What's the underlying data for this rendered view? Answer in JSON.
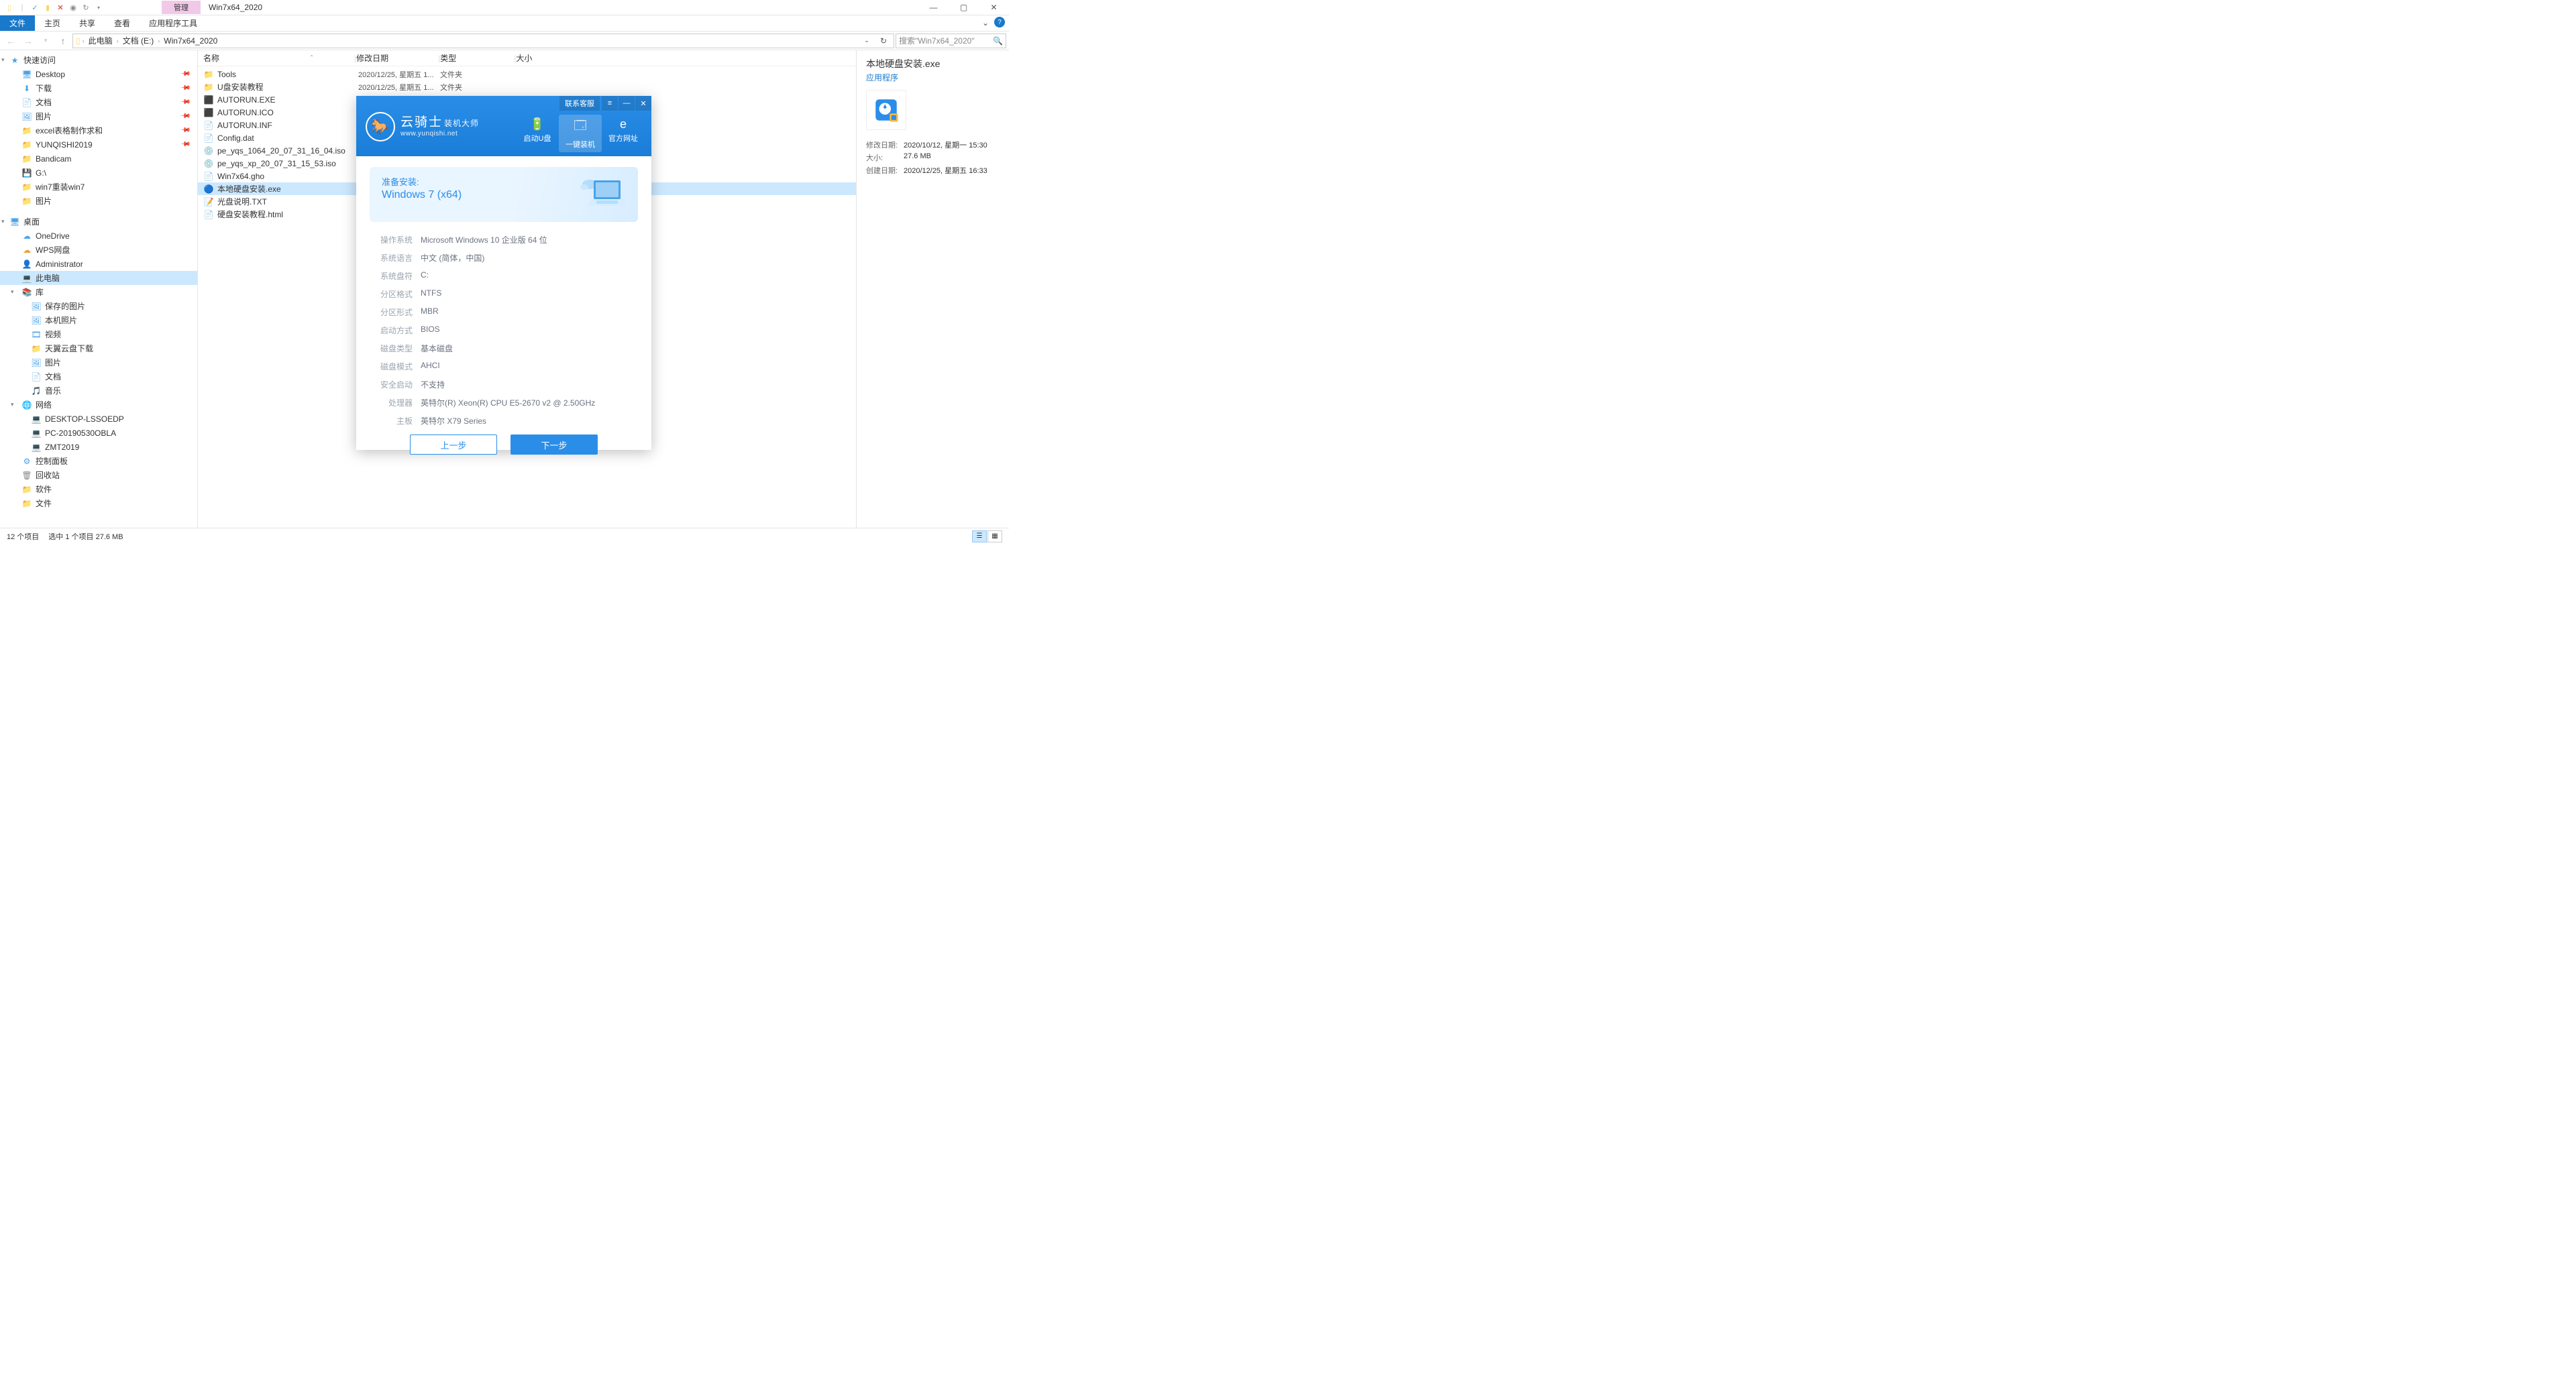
{
  "window": {
    "title": "Win7x64_2020",
    "manage_tab": "管理"
  },
  "ribbon": {
    "file": "文件",
    "tabs": [
      "主页",
      "共享",
      "查看",
      "应用程序工具"
    ]
  },
  "address": {
    "crumbs": [
      "此电脑",
      "文档 (E:)",
      "Win7x64_2020"
    ],
    "search_placeholder": "搜索\"Win7x64_2020\""
  },
  "nav": {
    "quick": {
      "label": "快速访问",
      "items": [
        {
          "label": "Desktop",
          "icon": "🖥",
          "cls": "ico-blue",
          "pin": true
        },
        {
          "label": "下载",
          "icon": "⬇",
          "cls": "ico-blue",
          "pin": true
        },
        {
          "label": "文档",
          "icon": "📄",
          "cls": "ico-blue",
          "pin": true
        },
        {
          "label": "图片",
          "icon": "🖼",
          "cls": "ico-blue",
          "pin": true
        },
        {
          "label": "excel表格制作求和",
          "icon": "📁",
          "cls": "ico-folder",
          "pin": true
        },
        {
          "label": "YUNQISHI2019",
          "icon": "📁",
          "cls": "ico-folder",
          "pin": true
        },
        {
          "label": "Bandicam",
          "icon": "📁",
          "cls": "ico-folder",
          "pin": false
        },
        {
          "label": "G:\\",
          "icon": "💾",
          "cls": "ico-disk",
          "pin": false
        },
        {
          "label": "win7重装win7",
          "icon": "📁",
          "cls": "ico-folder",
          "pin": false
        },
        {
          "label": "图片",
          "icon": "📁",
          "cls": "ico-folder",
          "pin": false
        }
      ]
    },
    "desktop": {
      "label": "桌面",
      "items": [
        {
          "label": "OneDrive",
          "icon": "☁",
          "cls": "ico-blue"
        },
        {
          "label": "WPS网盘",
          "icon": "☁",
          "cls": "ico-orange"
        },
        {
          "label": "Administrator",
          "icon": "👤",
          "cls": "ico-orange"
        },
        {
          "label": "此电脑",
          "icon": "💻",
          "cls": "ico-pc",
          "sel": true
        },
        {
          "label": "库",
          "icon": "📚",
          "cls": "ico-folder",
          "expandable": true,
          "children": [
            {
              "label": "保存的图片",
              "icon": "🖼",
              "cls": "ico-blue"
            },
            {
              "label": "本机照片",
              "icon": "🖼",
              "cls": "ico-blue"
            },
            {
              "label": "视频",
              "icon": "🎞",
              "cls": "ico-blue"
            },
            {
              "label": "天翼云盘下载",
              "icon": "📁",
              "cls": "ico-blue"
            },
            {
              "label": "图片",
              "icon": "🖼",
              "cls": "ico-blue"
            },
            {
              "label": "文档",
              "icon": "📄",
              "cls": "ico-blue"
            },
            {
              "label": "音乐",
              "icon": "🎵",
              "cls": "ico-blue"
            }
          ]
        },
        {
          "label": "网络",
          "icon": "🌐",
          "cls": "ico-net",
          "expandable": true,
          "children": [
            {
              "label": "DESKTOP-LSSOEDP",
              "icon": "💻",
              "cls": "ico-pc"
            },
            {
              "label": "PC-20190530OBLA",
              "icon": "💻",
              "cls": "ico-pc"
            },
            {
              "label": "ZMT2019",
              "icon": "💻",
              "cls": "ico-pc"
            }
          ]
        },
        {
          "label": "控制面板",
          "icon": "⚙",
          "cls": "ico-blue"
        },
        {
          "label": "回收站",
          "icon": "🗑",
          "cls": "ico-grey"
        },
        {
          "label": "软件",
          "icon": "📁",
          "cls": "ico-folder"
        },
        {
          "label": "文件",
          "icon": "📁",
          "cls": "ico-folder"
        }
      ]
    }
  },
  "columns": {
    "name": "名称",
    "date": "修改日期",
    "type": "类型",
    "size": "大小"
  },
  "files": [
    {
      "name": "Tools",
      "icon": "📁",
      "cls": "ico-folder",
      "date": "2020/12/25, 星期五 1...",
      "type": "文件夹",
      "size": ""
    },
    {
      "name": "U盘安装教程",
      "icon": "📁",
      "cls": "ico-folder",
      "date": "2020/12/25, 星期五 1...",
      "type": "文件夹",
      "size": ""
    },
    {
      "name": "AUTORUN.EXE",
      "icon": "⬛",
      "cls": "ico-green",
      "date": "",
      "type": "",
      "size": ""
    },
    {
      "name": "AUTORUN.ICO",
      "icon": "⬛",
      "cls": "ico-green",
      "date": "",
      "type": "",
      "size": ""
    },
    {
      "name": "AUTORUN.INF",
      "icon": "📄",
      "cls": "ico-grey",
      "date": "",
      "type": "",
      "size": ""
    },
    {
      "name": "Config.dat",
      "icon": "📄",
      "cls": "ico-grey",
      "date": "",
      "type": "",
      "size": ""
    },
    {
      "name": "pe_yqs_1064_20_07_31_16_04.iso",
      "icon": "💿",
      "cls": "ico-cd",
      "date": "",
      "type": "",
      "size": ""
    },
    {
      "name": "pe_yqs_xp_20_07_31_15_53.iso",
      "icon": "💿",
      "cls": "ico-cd",
      "date": "",
      "type": "",
      "size": ""
    },
    {
      "name": "Win7x64.gho",
      "icon": "📄",
      "cls": "ico-grey",
      "date": "",
      "type": "",
      "size": ""
    },
    {
      "name": "本地硬盘安装.exe",
      "icon": "🔵",
      "cls": "ico-blue",
      "date": "",
      "type": "",
      "size": "",
      "sel": true
    },
    {
      "name": "光盘说明.TXT",
      "icon": "📝",
      "cls": "ico-grey",
      "date": "",
      "type": "",
      "size": ""
    },
    {
      "name": "硬盘安装教程.html",
      "icon": "📄",
      "cls": "ico-grey",
      "date": "",
      "type": "",
      "size": ""
    }
  ],
  "details": {
    "title": "本地硬盘安装.exe",
    "type": "应用程序",
    "rows": [
      {
        "label": "修改日期:",
        "val": "2020/10/12, 星期一 15:30"
      },
      {
        "label": "大小:",
        "val": "27.6 MB"
      },
      {
        "label": "创建日期:",
        "val": "2020/12/25, 星期五 16:33"
      }
    ]
  },
  "status": {
    "count": "12 个项目",
    "sel": "选中 1 个项目  27.6 MB"
  },
  "installer": {
    "contact": "联系客服",
    "brand_main": "云骑士",
    "brand_sub": "装机大师",
    "brand_url": "www.yunqishi.net",
    "tabs": [
      {
        "label": "启动U盘",
        "icon": "🔋"
      },
      {
        "label": "一键装机",
        "icon": "🗔",
        "active": true
      },
      {
        "label": "官方网址",
        "icon": "e"
      }
    ],
    "prep_label": "准备安装:",
    "prep_os": "Windows 7 (x64)",
    "info": [
      {
        "label": "操作系统",
        "val": "Microsoft Windows 10 企业版 64 位"
      },
      {
        "label": "系统语言",
        "val": "中文 (简体，中国)"
      },
      {
        "label": "系统盘符",
        "val": "C:"
      },
      {
        "label": "分区格式",
        "val": "NTFS"
      },
      {
        "label": "分区形式",
        "val": "MBR"
      },
      {
        "label": "启动方式",
        "val": "BIOS"
      },
      {
        "label": "磁盘类型",
        "val": "基本磁盘"
      },
      {
        "label": "磁盘模式",
        "val": "AHCI"
      },
      {
        "label": "安全启动",
        "val": "不支持"
      },
      {
        "label": "处理器",
        "val": "英特尔(R) Xeon(R) CPU E5-2670 v2 @ 2.50GHz"
      },
      {
        "label": "主板",
        "val": "英特尔 X79 Series"
      }
    ],
    "btn_back": "上一步",
    "btn_next": "下一步"
  }
}
